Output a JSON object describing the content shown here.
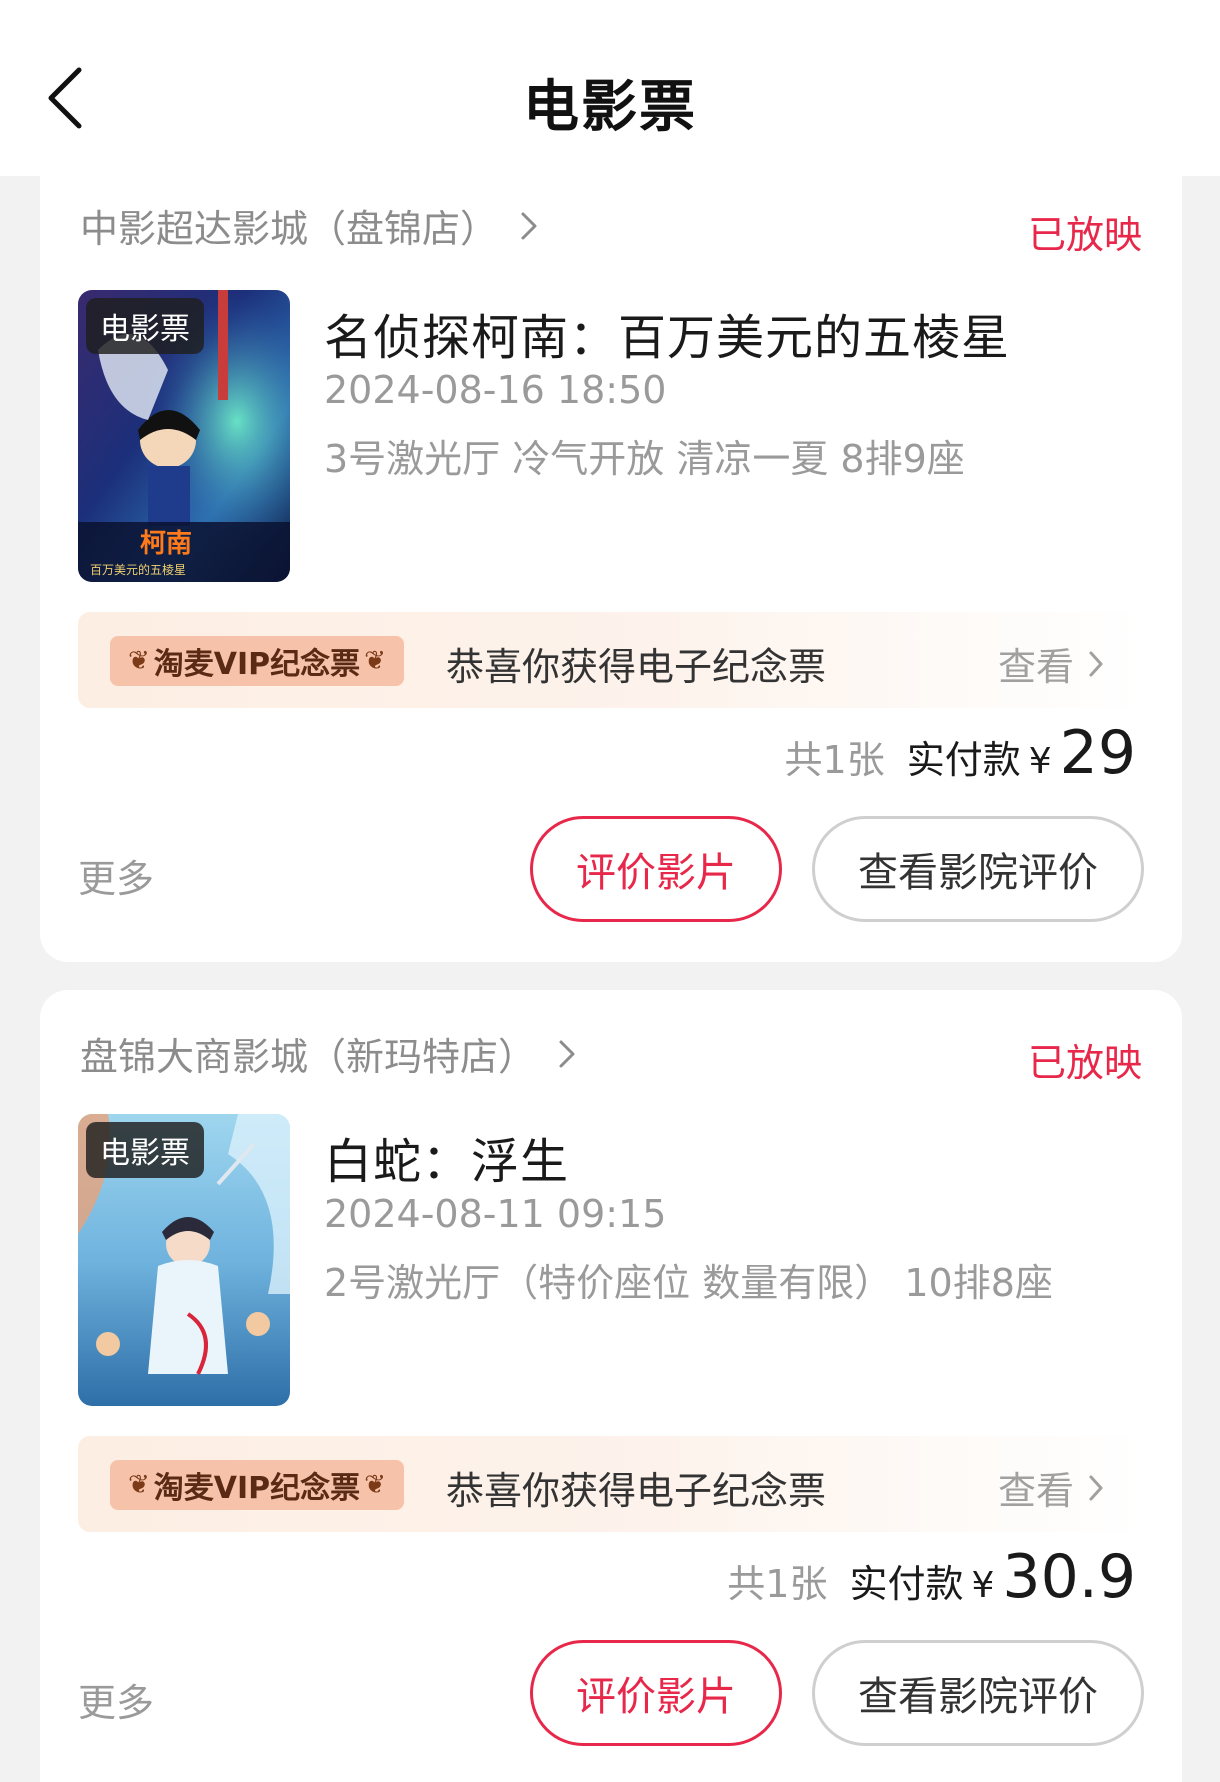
{
  "header": {
    "title": "电影票",
    "back_icon": "chevron-left-icon"
  },
  "orders": [
    {
      "cinema": "中影超达影城（盘锦店）",
      "status": "已放映",
      "poster_tag": "电影票",
      "movie_title": "名侦探柯南：百万美元的五棱星",
      "showtime": "2024-08-16 18:50",
      "seat_info": "3号激光厅 冷气开放 清凉一夏 8排9座",
      "vip_badge": "淘麦VIP纪念票",
      "vip_text": "恭喜你获得电子纪念票",
      "vip_view": "查看",
      "count": "共1张",
      "paid_label": "实付款",
      "currency": "¥",
      "amount": "29",
      "more": "更多",
      "rate_button": "评价影片",
      "cinema_review_button": "查看影院评价"
    },
    {
      "cinema": "盘锦大商影城（新玛特店）",
      "status": "已放映",
      "poster_tag": "电影票",
      "movie_title": "白蛇：浮生",
      "showtime": "2024-08-11 09:15",
      "seat_info": "2号激光厅（特价座位 数量有限） 10排8座",
      "vip_badge": "淘麦VIP纪念票",
      "vip_text": "恭喜你获得电子纪念票",
      "vip_view": "查看",
      "count": "共1张",
      "paid_label": "实付款",
      "currency": "¥",
      "amount": "30.9",
      "more": "更多",
      "rate_button": "评价影片",
      "cinema_review_button": "查看影院评价"
    }
  ],
  "colors": {
    "accent": "#e8284a",
    "muted": "#9a9a9a",
    "background": "#f2f2f2"
  }
}
